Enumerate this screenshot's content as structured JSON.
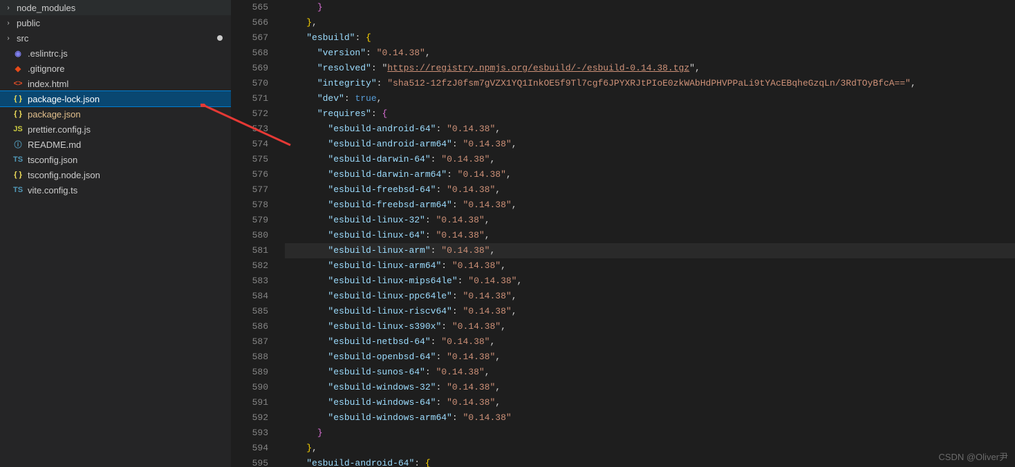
{
  "sidebar": {
    "items": [
      {
        "type": "folder",
        "name": "node_modules",
        "icon": "chevron",
        "color": "#c09553"
      },
      {
        "type": "folder",
        "name": "public",
        "icon": "chevron",
        "color": "#c09553"
      },
      {
        "type": "folder",
        "name": "src",
        "icon": "chevron",
        "color": "#c09553",
        "modified": true
      },
      {
        "type": "file",
        "name": ".eslintrc.js",
        "icon": "eslint",
        "color": "#8080f2"
      },
      {
        "type": "file",
        "name": ".gitignore",
        "icon": "git",
        "color": "#e64a19"
      },
      {
        "type": "file",
        "name": "index.html",
        "icon": "html",
        "color": "#e44d26"
      },
      {
        "type": "file",
        "name": "package-lock.json",
        "icon": "json",
        "color": "#f1e05a",
        "selected": true,
        "highlight": true
      },
      {
        "type": "file",
        "name": "package.json",
        "icon": "json",
        "color": "#f1e05a",
        "highlight": true
      },
      {
        "type": "file",
        "name": "prettier.config.js",
        "icon": "js",
        "color": "#cbcb41"
      },
      {
        "type": "file",
        "name": "README.md",
        "icon": "info",
        "color": "#519aba"
      },
      {
        "type": "file",
        "name": "tsconfig.json",
        "icon": "ts",
        "color": "#519aba"
      },
      {
        "type": "file",
        "name": "tsconfig.node.json",
        "icon": "json",
        "color": "#f1e05a"
      },
      {
        "type": "file",
        "name": "vite.config.ts",
        "icon": "TS",
        "color": "#519aba"
      }
    ]
  },
  "editor": {
    "startLine": 565,
    "activeLine": 581,
    "lines": [
      {
        "indent": 3,
        "tokens": [
          {
            "t": "brace2",
            "v": "}"
          }
        ]
      },
      {
        "indent": 2,
        "tokens": [
          {
            "t": "brace",
            "v": "}"
          },
          {
            "t": "punc",
            "v": ","
          }
        ]
      },
      {
        "indent": 2,
        "tokens": [
          {
            "t": "key",
            "v": "\"esbuild\""
          },
          {
            "t": "punc",
            "v": ": "
          },
          {
            "t": "brace",
            "v": "{"
          }
        ]
      },
      {
        "indent": 3,
        "tokens": [
          {
            "t": "key",
            "v": "\"version\""
          },
          {
            "t": "punc",
            "v": ": "
          },
          {
            "t": "str",
            "v": "\"0.14.38\""
          },
          {
            "t": "punc",
            "v": ","
          }
        ]
      },
      {
        "indent": 3,
        "tokens": [
          {
            "t": "key",
            "v": "\"resolved\""
          },
          {
            "t": "punc",
            "v": ": "
          },
          {
            "t": "punc",
            "v": "\""
          },
          {
            "t": "link",
            "v": "https://registry.npmjs.org/esbuild/-/esbuild-0.14.38.tgz"
          },
          {
            "t": "punc",
            "v": "\""
          },
          {
            "t": "punc",
            "v": ","
          }
        ]
      },
      {
        "indent": 3,
        "tokens": [
          {
            "t": "key",
            "v": "\"integrity\""
          },
          {
            "t": "punc",
            "v": ": "
          },
          {
            "t": "str",
            "v": "\"sha512-12fzJ0fsm7gVZX1YQ1InkOE5f9Tl7cgf6JPYXRJtPIoE0zkWAbHdPHVPPaLi9tYAcEBqheGzqLn/3RdTOyBfcA==\""
          },
          {
            "t": "punc",
            "v": ","
          }
        ]
      },
      {
        "indent": 3,
        "tokens": [
          {
            "t": "key",
            "v": "\"dev\""
          },
          {
            "t": "punc",
            "v": ": "
          },
          {
            "t": "bool",
            "v": "true"
          },
          {
            "t": "punc",
            "v": ","
          }
        ]
      },
      {
        "indent": 3,
        "tokens": [
          {
            "t": "key",
            "v": "\"requires\""
          },
          {
            "t": "punc",
            "v": ": "
          },
          {
            "t": "brace2",
            "v": "{"
          }
        ]
      },
      {
        "indent": 4,
        "tokens": [
          {
            "t": "key",
            "v": "\"esbuild-android-64\""
          },
          {
            "t": "punc",
            "v": ": "
          },
          {
            "t": "str",
            "v": "\"0.14.38\""
          },
          {
            "t": "punc",
            "v": ","
          }
        ]
      },
      {
        "indent": 4,
        "tokens": [
          {
            "t": "key",
            "v": "\"esbuild-android-arm64\""
          },
          {
            "t": "punc",
            "v": ": "
          },
          {
            "t": "str",
            "v": "\"0.14.38\""
          },
          {
            "t": "punc",
            "v": ","
          }
        ]
      },
      {
        "indent": 4,
        "tokens": [
          {
            "t": "key",
            "v": "\"esbuild-darwin-64\""
          },
          {
            "t": "punc",
            "v": ": "
          },
          {
            "t": "str",
            "v": "\"0.14.38\""
          },
          {
            "t": "punc",
            "v": ","
          }
        ]
      },
      {
        "indent": 4,
        "tokens": [
          {
            "t": "key",
            "v": "\"esbuild-darwin-arm64\""
          },
          {
            "t": "punc",
            "v": ": "
          },
          {
            "t": "str",
            "v": "\"0.14.38\""
          },
          {
            "t": "punc",
            "v": ","
          }
        ]
      },
      {
        "indent": 4,
        "tokens": [
          {
            "t": "key",
            "v": "\"esbuild-freebsd-64\""
          },
          {
            "t": "punc",
            "v": ": "
          },
          {
            "t": "str",
            "v": "\"0.14.38\""
          },
          {
            "t": "punc",
            "v": ","
          }
        ]
      },
      {
        "indent": 4,
        "tokens": [
          {
            "t": "key",
            "v": "\"esbuild-freebsd-arm64\""
          },
          {
            "t": "punc",
            "v": ": "
          },
          {
            "t": "str",
            "v": "\"0.14.38\""
          },
          {
            "t": "punc",
            "v": ","
          }
        ]
      },
      {
        "indent": 4,
        "tokens": [
          {
            "t": "key",
            "v": "\"esbuild-linux-32\""
          },
          {
            "t": "punc",
            "v": ": "
          },
          {
            "t": "str",
            "v": "\"0.14.38\""
          },
          {
            "t": "punc",
            "v": ","
          }
        ]
      },
      {
        "indent": 4,
        "tokens": [
          {
            "t": "key",
            "v": "\"esbuild-linux-64\""
          },
          {
            "t": "punc",
            "v": ": "
          },
          {
            "t": "str",
            "v": "\"0.14.38\""
          },
          {
            "t": "punc",
            "v": ","
          }
        ]
      },
      {
        "indent": 4,
        "tokens": [
          {
            "t": "key",
            "v": "\"esbuild-linux-arm\""
          },
          {
            "t": "punc",
            "v": ": "
          },
          {
            "t": "str",
            "v": "\"0.14.38\""
          },
          {
            "t": "punc",
            "v": ","
          }
        ]
      },
      {
        "indent": 4,
        "tokens": [
          {
            "t": "key",
            "v": "\"esbuild-linux-arm64\""
          },
          {
            "t": "punc",
            "v": ": "
          },
          {
            "t": "str",
            "v": "\"0.14.38\""
          },
          {
            "t": "punc",
            "v": ","
          }
        ]
      },
      {
        "indent": 4,
        "tokens": [
          {
            "t": "key",
            "v": "\"esbuild-linux-mips64le\""
          },
          {
            "t": "punc",
            "v": ": "
          },
          {
            "t": "str",
            "v": "\"0.14.38\""
          },
          {
            "t": "punc",
            "v": ","
          }
        ]
      },
      {
        "indent": 4,
        "tokens": [
          {
            "t": "key",
            "v": "\"esbuild-linux-ppc64le\""
          },
          {
            "t": "punc",
            "v": ": "
          },
          {
            "t": "str",
            "v": "\"0.14.38\""
          },
          {
            "t": "punc",
            "v": ","
          }
        ]
      },
      {
        "indent": 4,
        "tokens": [
          {
            "t": "key",
            "v": "\"esbuild-linux-riscv64\""
          },
          {
            "t": "punc",
            "v": ": "
          },
          {
            "t": "str",
            "v": "\"0.14.38\""
          },
          {
            "t": "punc",
            "v": ","
          }
        ]
      },
      {
        "indent": 4,
        "tokens": [
          {
            "t": "key",
            "v": "\"esbuild-linux-s390x\""
          },
          {
            "t": "punc",
            "v": ": "
          },
          {
            "t": "str",
            "v": "\"0.14.38\""
          },
          {
            "t": "punc",
            "v": ","
          }
        ]
      },
      {
        "indent": 4,
        "tokens": [
          {
            "t": "key",
            "v": "\"esbuild-netbsd-64\""
          },
          {
            "t": "punc",
            "v": ": "
          },
          {
            "t": "str",
            "v": "\"0.14.38\""
          },
          {
            "t": "punc",
            "v": ","
          }
        ]
      },
      {
        "indent": 4,
        "tokens": [
          {
            "t": "key",
            "v": "\"esbuild-openbsd-64\""
          },
          {
            "t": "punc",
            "v": ": "
          },
          {
            "t": "str",
            "v": "\"0.14.38\""
          },
          {
            "t": "punc",
            "v": ","
          }
        ]
      },
      {
        "indent": 4,
        "tokens": [
          {
            "t": "key",
            "v": "\"esbuild-sunos-64\""
          },
          {
            "t": "punc",
            "v": ": "
          },
          {
            "t": "str",
            "v": "\"0.14.38\""
          },
          {
            "t": "punc",
            "v": ","
          }
        ]
      },
      {
        "indent": 4,
        "tokens": [
          {
            "t": "key",
            "v": "\"esbuild-windows-32\""
          },
          {
            "t": "punc",
            "v": ": "
          },
          {
            "t": "str",
            "v": "\"0.14.38\""
          },
          {
            "t": "punc",
            "v": ","
          }
        ]
      },
      {
        "indent": 4,
        "tokens": [
          {
            "t": "key",
            "v": "\"esbuild-windows-64\""
          },
          {
            "t": "punc",
            "v": ": "
          },
          {
            "t": "str",
            "v": "\"0.14.38\""
          },
          {
            "t": "punc",
            "v": ","
          }
        ]
      },
      {
        "indent": 4,
        "tokens": [
          {
            "t": "key",
            "v": "\"esbuild-windows-arm64\""
          },
          {
            "t": "punc",
            "v": ": "
          },
          {
            "t": "str",
            "v": "\"0.14.38\""
          }
        ]
      },
      {
        "indent": 3,
        "tokens": [
          {
            "t": "brace2",
            "v": "}"
          }
        ]
      },
      {
        "indent": 2,
        "tokens": [
          {
            "t": "brace",
            "v": "}"
          },
          {
            "t": "punc",
            "v": ","
          }
        ]
      },
      {
        "indent": 2,
        "tokens": [
          {
            "t": "key",
            "v": "\"esbuild-android-64\""
          },
          {
            "t": "punc",
            "v": ": "
          },
          {
            "t": "brace",
            "v": "{"
          }
        ]
      }
    ]
  },
  "watermark": "CSDN @Oliver尹",
  "iconGlyphs": {
    "eslint": "◉",
    "git": "◆",
    "html": "<>",
    "json": "{ }",
    "js": "JS",
    "info": "ⓘ",
    "ts": "TS",
    "TS": "TS"
  }
}
